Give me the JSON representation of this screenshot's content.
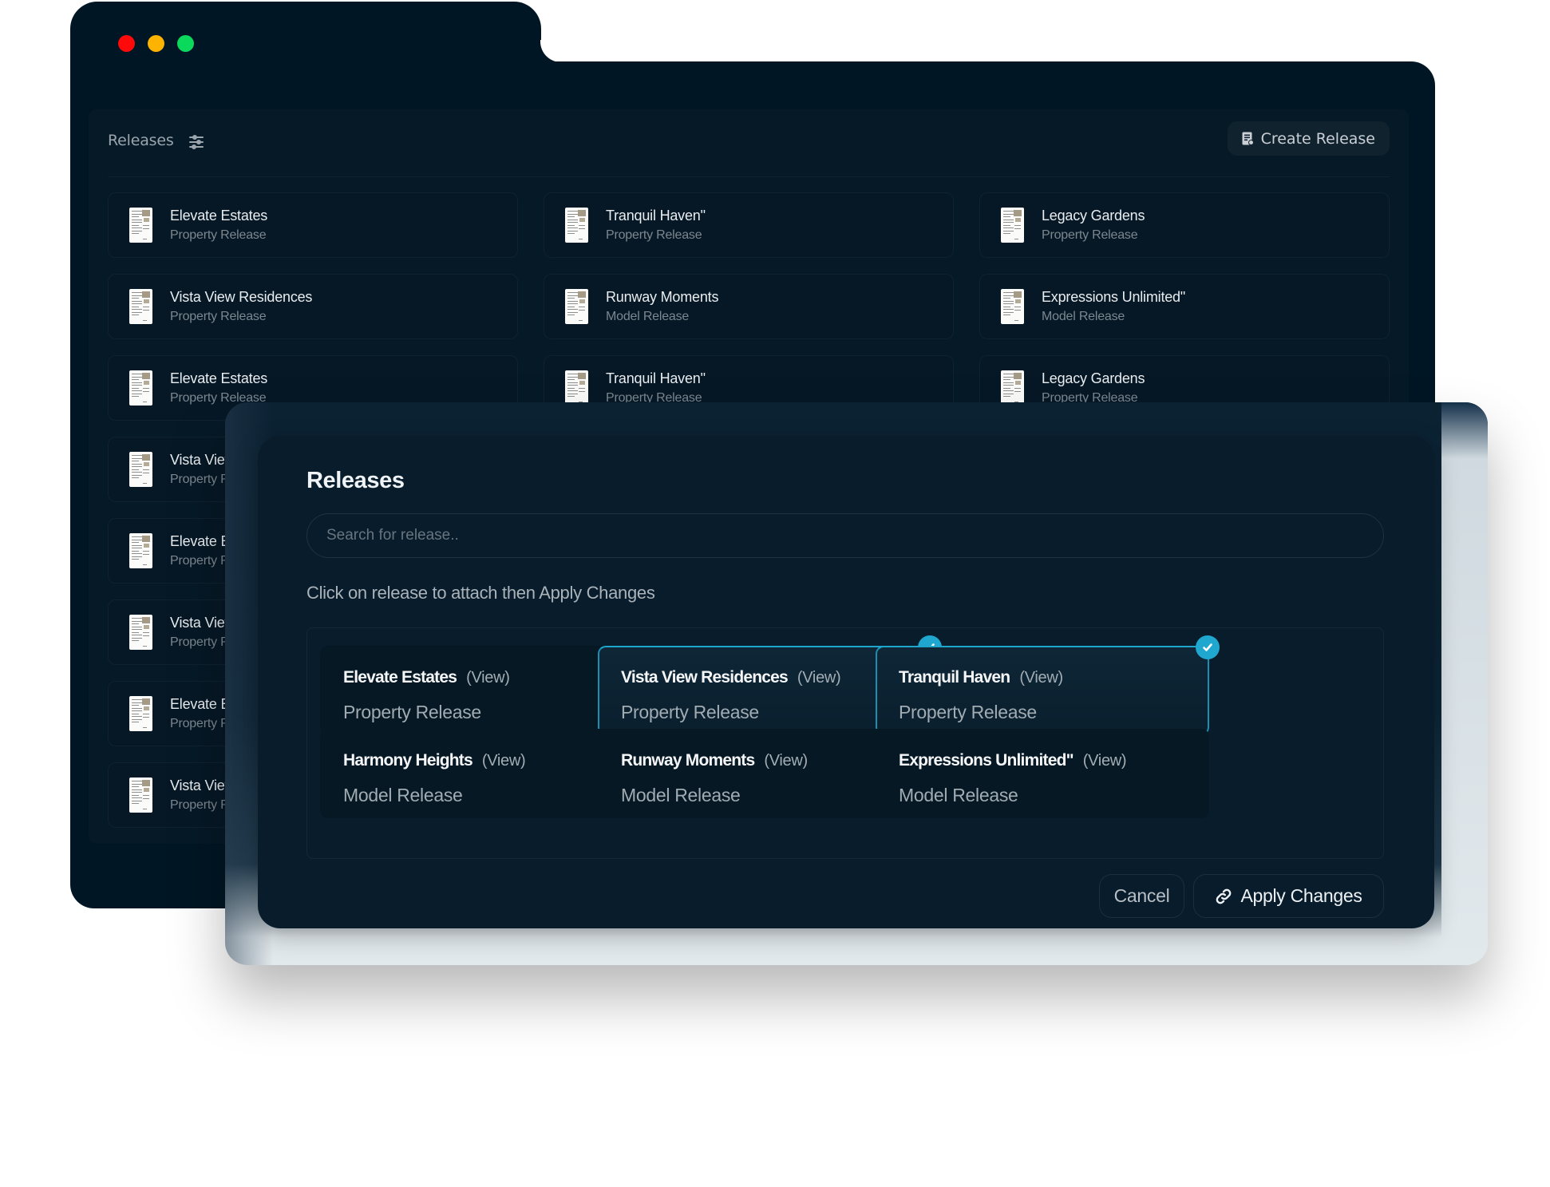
{
  "window": {
    "traffic_lights": [
      {
        "name": "close",
        "color": "#ff0a0a"
      },
      {
        "name": "minimize",
        "color": "#fdb300"
      },
      {
        "name": "maximize",
        "color": "#0ad95c"
      }
    ]
  },
  "panel": {
    "title": "Releases",
    "filter_icon": "sliders-icon",
    "create_button": {
      "label": "Create Release",
      "icon": "document-badge-icon"
    }
  },
  "releases": [
    {
      "title": "Elevate Estates",
      "type": "Property Release"
    },
    {
      "title": "Tranquil Haven\"",
      "type": "Property Release"
    },
    {
      "title": "Legacy Gardens",
      "type": "Property Release"
    },
    {
      "title": "Vista View Residences",
      "type": "Property Release"
    },
    {
      "title": "Runway Moments",
      "type": "Model Release"
    },
    {
      "title": "Expressions Unlimited\"",
      "type": "Model Release"
    },
    {
      "title": "Elevate Estates",
      "type": "Property Release"
    },
    {
      "title": "Tranquil Haven\"",
      "type": "Property Release"
    },
    {
      "title": "Legacy Gardens",
      "type": "Property Release"
    },
    {
      "title": "Vista View Residences",
      "type": "Property Release"
    },
    {
      "title": "",
      "type": ""
    },
    {
      "title": "",
      "type": ""
    },
    {
      "title": "Elevate Estates",
      "type": "Property Release"
    },
    {
      "title": "",
      "type": ""
    },
    {
      "title": "",
      "type": ""
    },
    {
      "title": "Vista View Residences",
      "type": "Property Release"
    },
    {
      "title": "",
      "type": ""
    },
    {
      "title": "",
      "type": ""
    },
    {
      "title": "Elevate Estates",
      "type": "Property Release"
    },
    {
      "title": "",
      "type": ""
    },
    {
      "title": "",
      "type": ""
    },
    {
      "title": "Vista View Residences",
      "type": "Property Release"
    }
  ],
  "modal": {
    "title": "Releases",
    "search": {
      "placeholder": "Search for release..",
      "value": ""
    },
    "hint": "Click on release to attach then Apply Changes",
    "view_label": "(View)",
    "accent_color": "#1fa7cf",
    "items": [
      {
        "title": "Elevate Estates",
        "type": "Property Release",
        "selected": false
      },
      {
        "title": "Vista View Residences",
        "type": "Property Release",
        "selected": true
      },
      {
        "title": "Tranquil Haven",
        "type": "Property Release",
        "selected": true
      },
      {
        "title": "Harmony Heights",
        "type": "Model Release",
        "selected": false
      },
      {
        "title": "Runway Moments",
        "type": "Model Release",
        "selected": false
      },
      {
        "title": "Expressions Unlimited\"",
        "type": "Model Release",
        "selected": false
      }
    ],
    "cancel_label": "Cancel",
    "apply_label": "Apply Changes",
    "apply_icon": "link-icon"
  }
}
